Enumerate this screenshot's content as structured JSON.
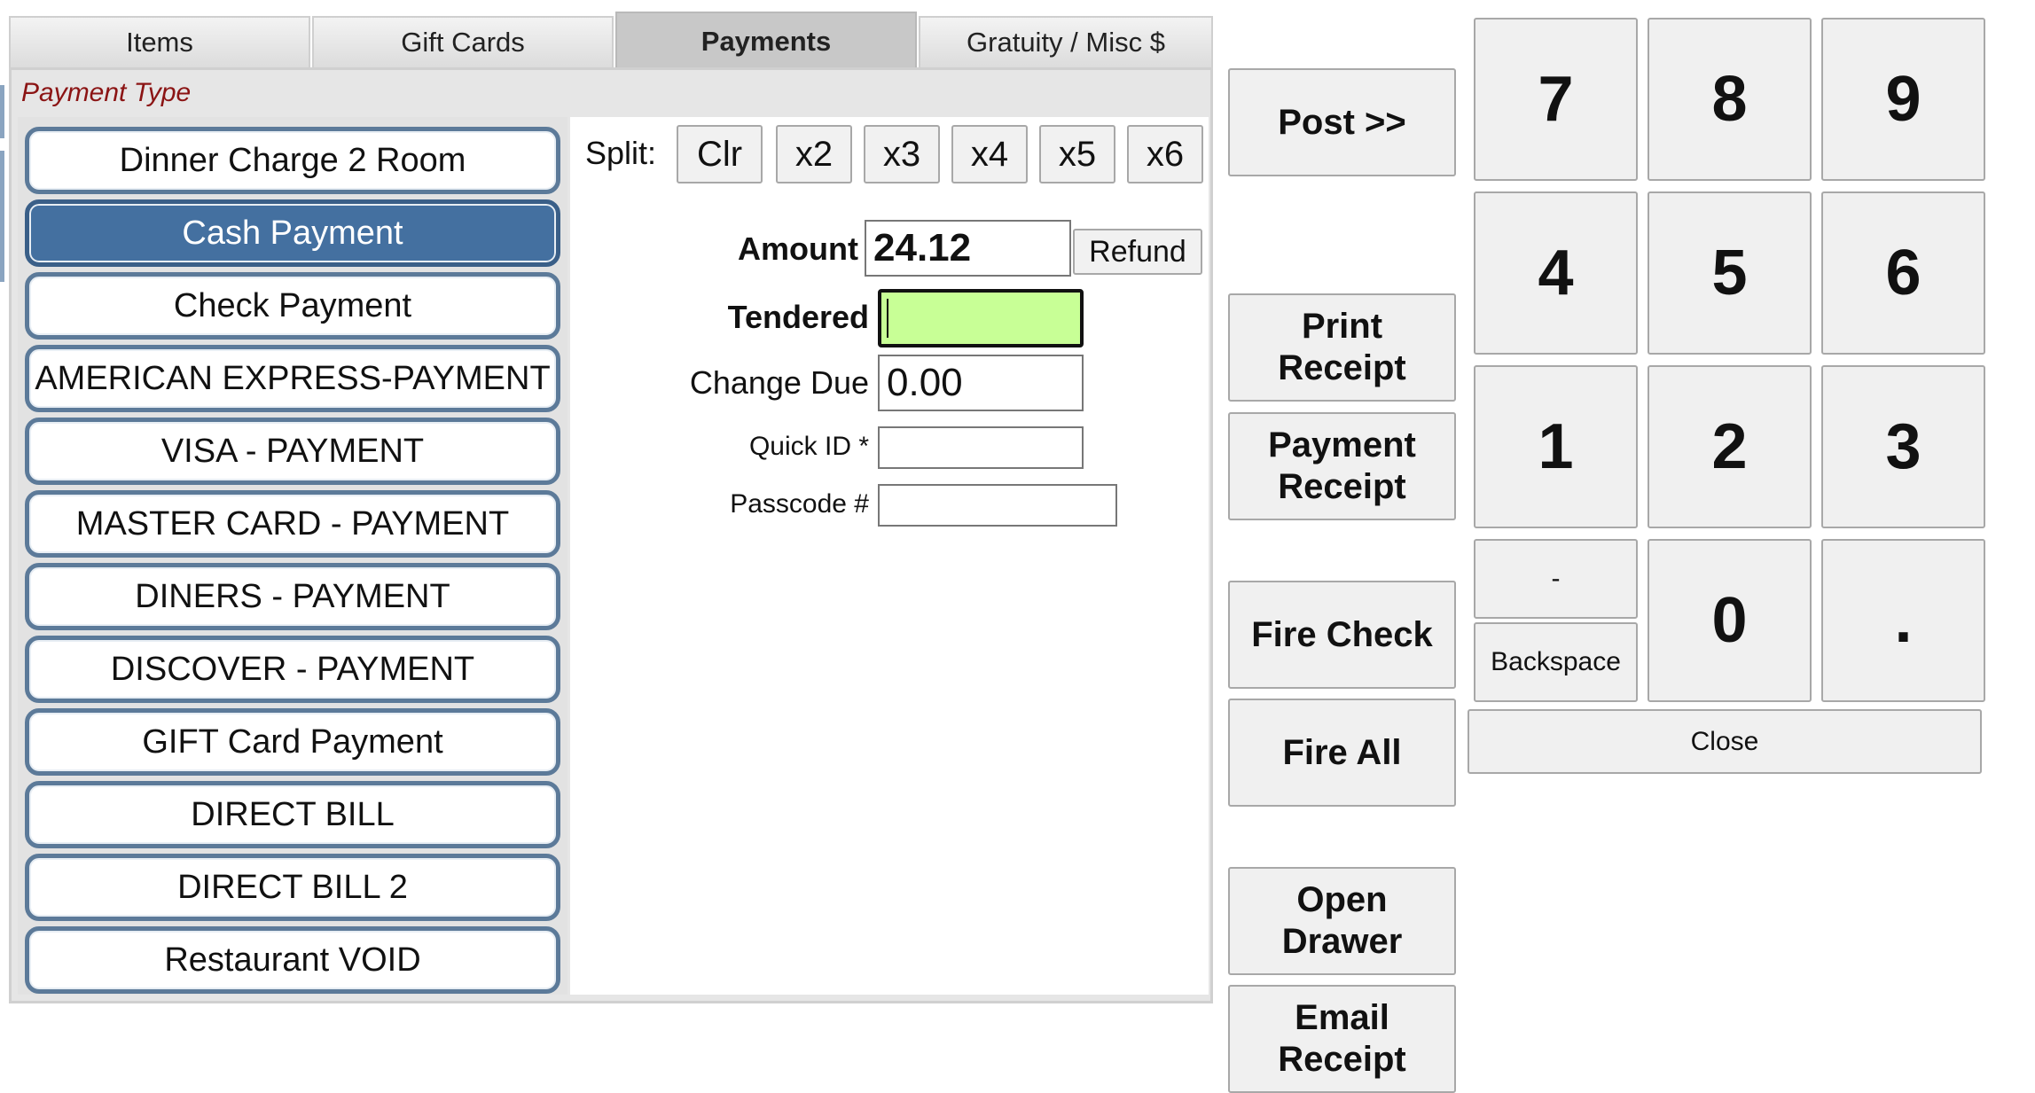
{
  "tabs": [
    "Items",
    "Gift Cards",
    "Payments",
    "Gratuity / Misc $"
  ],
  "active_tab": "Payments",
  "payment_type_label": "Payment Type",
  "payment_types": [
    "Dinner Charge 2 Room",
    "Cash Payment",
    "Check Payment",
    "AMERICAN EXPRESS-PAYMENT",
    "VISA - PAYMENT",
    "MASTER CARD - PAYMENT",
    "DINERS - PAYMENT",
    "DISCOVER - PAYMENT",
    "GIFT Card Payment",
    "DIRECT BILL",
    "DIRECT BILL 2",
    "Restaurant VOID"
  ],
  "selected_payment": "Cash Payment",
  "split": {
    "label": "Split:",
    "buttons": [
      "Clr",
      "x2",
      "x3",
      "x4",
      "x5",
      "x6"
    ]
  },
  "form": {
    "amount_label": "Amount",
    "amount_value": "24.12",
    "refund_label": "Refund",
    "tendered_label": "Tendered",
    "tendered_value": "",
    "change_due_label": "Change Due",
    "change_due_value": "0.00",
    "quick_id_label": "Quick ID *",
    "quick_id_value": "",
    "passcode_label": "Passcode #",
    "passcode_value": ""
  },
  "actions": {
    "post": "Post >>",
    "print_receipt": [
      "Print",
      "Receipt"
    ],
    "payment_receipt": [
      "Payment",
      "Receipt"
    ],
    "fire_check": "Fire Check",
    "fire_all": "Fire All",
    "open_drawer": [
      "Open",
      "Drawer"
    ],
    "email_receipt": [
      "Email",
      "Receipt"
    ]
  },
  "keypad": {
    "digits": [
      "7",
      "8",
      "9",
      "4",
      "5",
      "6",
      "1",
      "2",
      "3"
    ],
    "minus": "-",
    "backspace": "Backspace",
    "zero": "0",
    "dot": ".",
    "close": "Close"
  },
  "colors": {
    "selected_payment_bg": "#4470a0",
    "tendered_bg": "#c8ff96",
    "payment_type_label": "#8b1414"
  }
}
